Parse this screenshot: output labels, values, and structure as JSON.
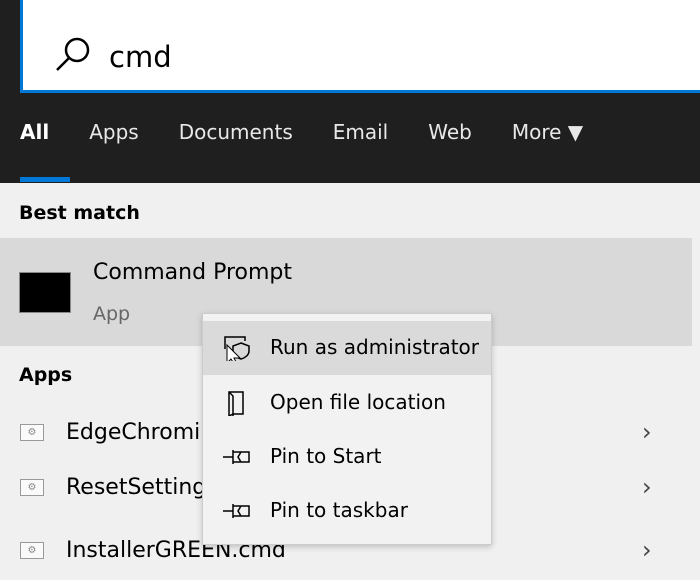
{
  "search": {
    "query": "cmd",
    "icon": "search-icon"
  },
  "tabs": [
    {
      "label": "All",
      "active": true
    },
    {
      "label": "Apps"
    },
    {
      "label": "Documents"
    },
    {
      "label": "Email"
    },
    {
      "label": "Web"
    },
    {
      "label": "More ▼"
    }
  ],
  "best_match": {
    "heading": "Best match",
    "title": "Command Prompt",
    "subtitle": "App"
  },
  "apps": {
    "heading": "Apps",
    "items": [
      {
        "label": "EdgeChromi"
      },
      {
        "label": "ResetSetting"
      },
      {
        "label": "InstallerGREEN.cmd"
      }
    ]
  },
  "context_menu": {
    "items": [
      {
        "label": "Run as administrator",
        "icon": "shield-icon"
      },
      {
        "label": "Open file location",
        "icon": "folder-icon"
      },
      {
        "label": "Pin to Start",
        "icon": "pin-icon"
      },
      {
        "label": "Pin to taskbar",
        "icon": "pin-icon"
      }
    ]
  },
  "colors": {
    "accent": "#0078d7",
    "header": "#1f1f1f"
  }
}
